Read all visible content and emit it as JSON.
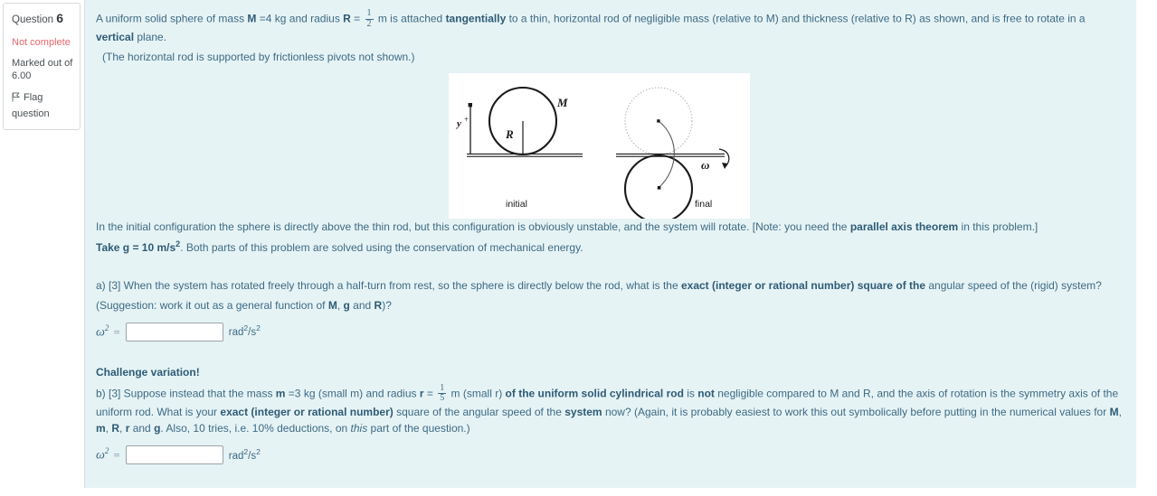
{
  "sidebar": {
    "question_label": "Question",
    "question_number": "6",
    "state": "Not complete",
    "marked_out_of_line1": "Marked out of",
    "marked_out_of_line2": "6.00",
    "flag_label": "Flag",
    "flag_label2": "question",
    "flag_icon": "flag-icon",
    "state_color": "#e8666d"
  },
  "question": {
    "intro_a": "A uniform solid sphere of mass ",
    "intro_M": "M",
    "intro_b": " =4 kg and radius ",
    "intro_R": "R",
    "intro_c": " = ",
    "frac1_num": "1",
    "frac1_den": "2",
    "intro_d": " m is attached ",
    "intro_tangentially": "tangentially",
    "intro_e": " to a thin, horizontal rod of negligible mass (relative to M) and thickness (relative to R) as shown, and is free to rotate in a ",
    "intro_vertical": "vertical",
    "intro_f": " plane.",
    "paren_line": "(The horizontal rod is supported by frictionless pivots not shown.)",
    "note_a": "In the initial configuration the sphere is directly above the thin rod, but this configuration is obviously unstable, and the system will rotate.  [Note: you need the ",
    "note_bold": "parallel axis theorem",
    "note_b": " in this problem.]",
    "take_g_bold": "Take g = 10 m/s",
    "take_g_sup": "2",
    "take_g_rest": ".  Both parts of this problem are solved using the conservation of mechanical energy."
  },
  "figure": {
    "label_M": "M",
    "label_R": "R",
    "label_y": "y",
    "label_y_sup": "+",
    "label_omega": "ω",
    "caption_initial": "initial",
    "caption_final": "final",
    "stroke": "#1a1a1a",
    "ghost_stroke": "#b9b9b9"
  },
  "part_a": {
    "text_1": "a) [3] When the system has rotated freely through a half-turn from rest, so the sphere is directly below the rod, what is the ",
    "bold_1": "exact (integer or rational number) square of the",
    "text_2": " angular speed of the (rigid) system?",
    "text_3": "(Suggestion: work it out as a general function of ",
    "bold_M": "M",
    "comma_1": ", ",
    "bold_g": "g",
    "and_1": " and ",
    "bold_R": "R",
    "text_4": ")?",
    "omega_label": "ω",
    "omega_sup": "2",
    "equals": "=",
    "input_value": "",
    "input_placeholder": "",
    "unit_pre": "rad",
    "unit_sup1": "2",
    "unit_mid": "/s",
    "unit_sup2": "2"
  },
  "part_b": {
    "challenge_heading": "Challenge variation!",
    "text_1": "b) [3]  Suppose instead that the mass ",
    "bold_m": "m",
    "text_2": " =3 kg (small m) and radius ",
    "bold_r": "r",
    "text_3": " = ",
    "frac_num": "1",
    "frac_den": "5",
    "text_4": " m (small r) ",
    "bold_1": "of the uniform solid cylindrical rod",
    "text_5": " is ",
    "bold_not": "not",
    "text_6": " negligible compared to M and R, and the axis of rotation is the symmetry axis of the uniform rod.  What is your ",
    "bold_2": "exact (integer or rational number)",
    "text_7": " square of the angular speed of the ",
    "bold_system": "system",
    "text_8": " now?  (Again, it is probably easiest to work this out symbolically before putting in the numerical values for ",
    "bold_M": "M",
    "c1": ", ",
    "bold_m2": "m",
    "c2": ", ",
    "bold_R": "R",
    "c3": ", ",
    "bold_r2": "r",
    "and": " and ",
    "bold_g": "g",
    "text_9": ".  Also, 10 tries, i.e. 10% deductions, on ",
    "italic_this": "this",
    "text_10": " part of the question.)",
    "omega_label": "ω",
    "omega_sup": "2",
    "equals": "=",
    "input_value": "",
    "input_placeholder": "",
    "unit_pre": "rad",
    "unit_sup1": "2",
    "unit_mid": "/s",
    "unit_sup2": "2"
  }
}
